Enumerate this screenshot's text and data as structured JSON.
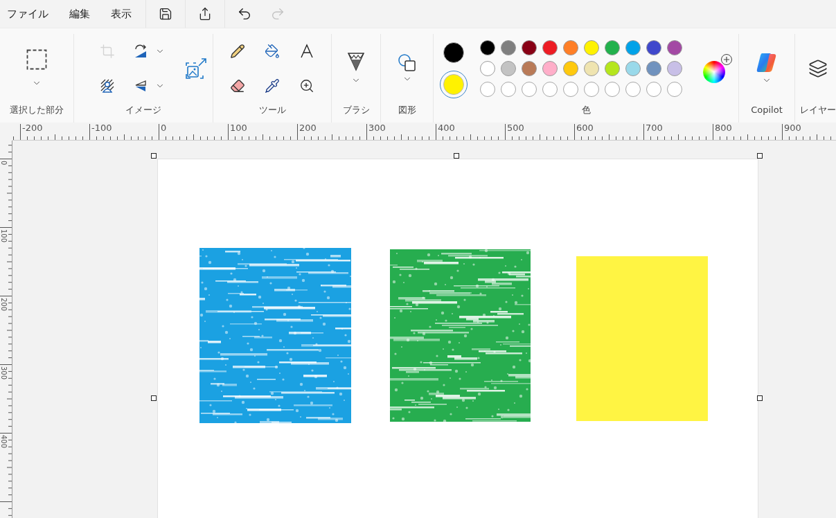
{
  "menu": [
    {
      "label": "ファイル"
    },
    {
      "label": "編集"
    },
    {
      "label": "表示"
    }
  ],
  "quick_access": [
    {
      "kind": "save",
      "disabled": false
    },
    {
      "kind": "share",
      "disabled": false
    },
    {
      "kind": "undo",
      "disabled": false
    },
    {
      "kind": "redo",
      "disabled": true
    }
  ],
  "ribbon": {
    "groups": [
      {
        "kind": "selection",
        "label": "選択した部分"
      },
      {
        "kind": "image",
        "label": "イメージ",
        "tools": [
          {
            "kind": "crop",
            "disabled": true
          },
          {
            "kind": "rotate",
            "disabled": false
          },
          {
            "kind": "resize",
            "disabled": false
          },
          {
            "kind": "remove-background",
            "disabled": false
          },
          {
            "kind": "flip",
            "disabled": false
          }
        ]
      },
      {
        "kind": "tools",
        "label": "ツール",
        "tools": [
          {
            "kind": "pencil"
          },
          {
            "kind": "fill"
          },
          {
            "kind": "text"
          },
          {
            "kind": "eraser"
          },
          {
            "kind": "picker"
          },
          {
            "kind": "magnifier"
          }
        ]
      },
      {
        "kind": "brush",
        "label": "ブラシ"
      },
      {
        "kind": "shapes",
        "label": "図形"
      },
      {
        "kind": "colors",
        "label": "色",
        "current": [
          {
            "color": "#000000",
            "selected": false
          },
          {
            "color": "#fff200",
            "selected": true
          }
        ],
        "palette": [
          {
            "kind": "swatch",
            "color": "#000000"
          },
          {
            "kind": "swatch",
            "color": "#7f7f7f"
          },
          {
            "kind": "swatch",
            "color": "#880015"
          },
          {
            "kind": "swatch",
            "color": "#ed1c24"
          },
          {
            "kind": "swatch",
            "color": "#ff7f27"
          },
          {
            "kind": "swatch",
            "color": "#fff200"
          },
          {
            "kind": "swatch",
            "color": "#22b14c"
          },
          {
            "kind": "swatch",
            "color": "#00a2e8"
          },
          {
            "kind": "swatch",
            "color": "#3f48cc"
          },
          {
            "kind": "swatch",
            "color": "#a349a4"
          },
          {
            "kind": "swatch",
            "color": "#ffffff"
          },
          {
            "kind": "swatch",
            "color": "#c3c3c3"
          },
          {
            "kind": "swatch",
            "color": "#b97a57"
          },
          {
            "kind": "swatch",
            "color": "#ffaec9"
          },
          {
            "kind": "swatch",
            "color": "#ffc90e"
          },
          {
            "kind": "swatch",
            "color": "#efe4b0"
          },
          {
            "kind": "swatch",
            "color": "#b5e61d"
          },
          {
            "kind": "swatch",
            "color": "#99d9ea"
          },
          {
            "kind": "swatch",
            "color": "#7092be"
          },
          {
            "kind": "swatch",
            "color": "#c8bfe7"
          },
          {
            "kind": "empty"
          },
          {
            "kind": "empty"
          },
          {
            "kind": "empty"
          },
          {
            "kind": "empty"
          },
          {
            "kind": "empty"
          },
          {
            "kind": "empty"
          },
          {
            "kind": "empty"
          },
          {
            "kind": "empty"
          },
          {
            "kind": "empty"
          },
          {
            "kind": "empty"
          }
        ]
      },
      {
        "kind": "copilot",
        "label": "Copilot"
      },
      {
        "kind": "layers",
        "label": "レイヤー"
      }
    ]
  },
  "horizontal_ruler": {
    "labels": [
      "-200",
      "-100",
      "0",
      "100",
      "200",
      "300",
      "400",
      "500",
      "600",
      "700",
      "800",
      "900"
    ]
  },
  "vertical_ruler": {
    "labels": [
      "0",
      "100",
      "200",
      "300",
      "400"
    ]
  },
  "canvas": {
    "shapes": [
      {
        "kind": "crayon",
        "color": "#1ba1e2"
      },
      {
        "kind": "crayon",
        "color": "#27ad4f"
      },
      {
        "kind": "solid",
        "color": "#fff443"
      }
    ]
  }
}
